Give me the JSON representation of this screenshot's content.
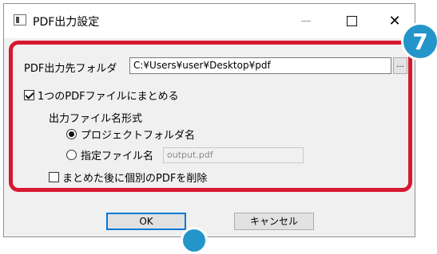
{
  "window": {
    "title": "PDF出力設定",
    "controls": {
      "minimize": "—",
      "maximize": "☐",
      "close": "✕"
    }
  },
  "badge": {
    "number": "7",
    "color": "#2495c9"
  },
  "highlight_color": "#d71830",
  "form": {
    "output_folder_label": "PDF出力先フォルダ",
    "output_folder_value": "C:¥Users¥user¥Desktop¥pdf",
    "browse_label": "...",
    "combine_label": "1つのPDFファイルにまとめる",
    "combine_checked": true,
    "filename_format_label": "出力ファイル名形式",
    "radio_project_label": "プロジェクトフォルダ名",
    "radio_project_selected": true,
    "radio_custom_label": "指定ファイル名",
    "custom_filename_placeholder": "output.pdf",
    "delete_after_label": "まとめた後に個別のPDFを削除",
    "delete_after_checked": false
  },
  "buttons": {
    "ok": "OK",
    "cancel": "キャンセル"
  }
}
